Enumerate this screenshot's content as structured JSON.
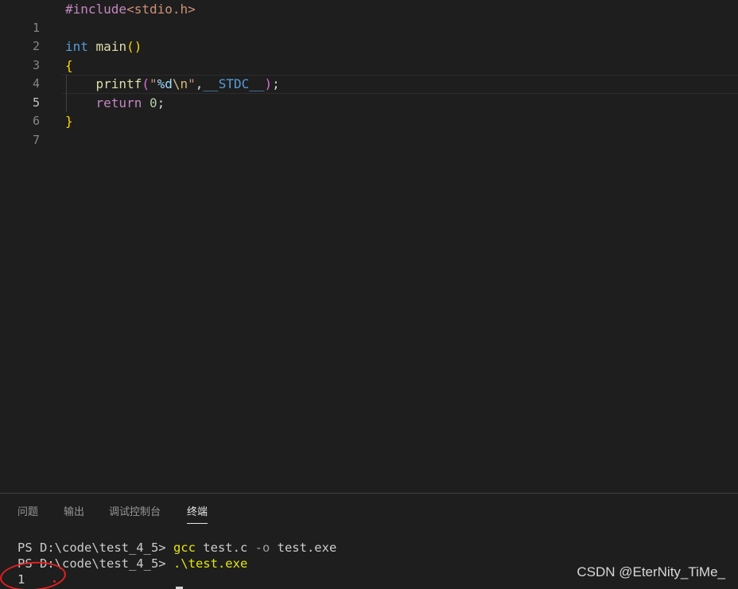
{
  "editor": {
    "lines": [
      {
        "number": "1",
        "parts": [
          "#include",
          "<stdio.h>"
        ]
      },
      {
        "number": "2",
        "parts": []
      },
      {
        "number": "3",
        "parts": [
          "int",
          " ",
          "main",
          "(",
          ")"
        ]
      },
      {
        "number": "4",
        "parts": [
          "{"
        ]
      },
      {
        "number": "5",
        "parts": [
          "    ",
          "printf",
          "(",
          "\"",
          "%d",
          "\\n",
          "\"",
          ",",
          "__STDC__",
          ")",
          ";"
        ]
      },
      {
        "number": "6",
        "parts": [
          "    ",
          "return",
          " ",
          "0",
          ";"
        ]
      },
      {
        "number": "7",
        "parts": [
          "}"
        ]
      }
    ],
    "active_line": "5"
  },
  "panel": {
    "tabs": [
      "问题",
      "输出",
      "调试控制台",
      "终端"
    ],
    "active_tab": "终端"
  },
  "terminal": {
    "line1": {
      "prompt": "PS D:\\code\\test_4_5> ",
      "cmd": "gcc",
      "arg1": " test.c ",
      "flag": "-o",
      "arg2": " test.exe"
    },
    "line2": {
      "prompt": "PS D:\\code\\test_4_5> ",
      "cmd": ".\\test.exe"
    },
    "output": "1"
  },
  "watermark": "CSDN @EterNity_TiMe_",
  "colors": {
    "background": "#1e1e1e",
    "annotation_ring": "#e02020"
  }
}
